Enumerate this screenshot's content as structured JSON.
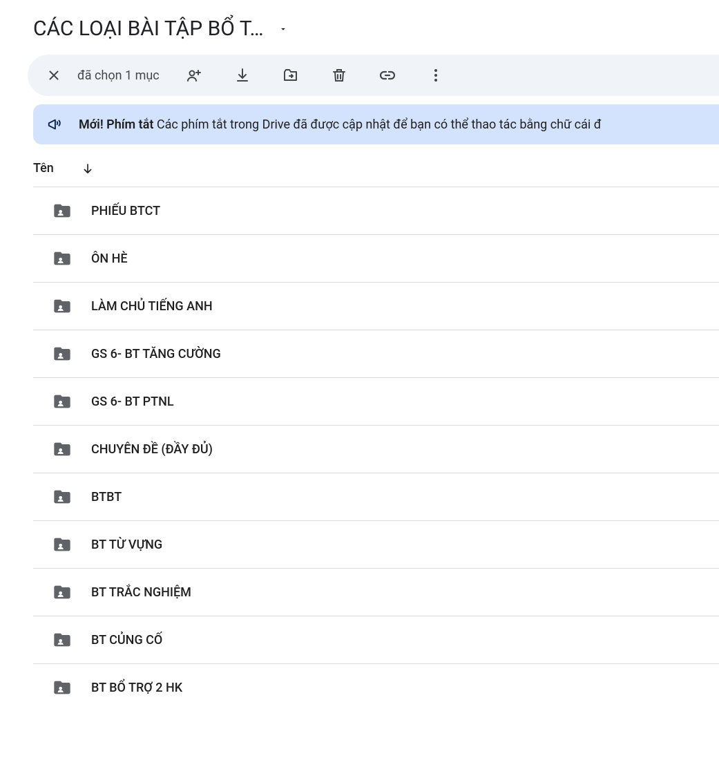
{
  "header": {
    "title": "CÁC LOẠI BÀI TẬP BỔ T…"
  },
  "toolbar": {
    "selection_text": "đã chọn 1 mục"
  },
  "banner": {
    "bold": "Mới! Phím tắt",
    "text": " Các phím tắt trong Drive đã được cập nhật để bạn có thể thao tác bằng chữ cái đ"
  },
  "columns": {
    "name": "Tên"
  },
  "files": [
    {
      "name": "PHIẾU BTCT"
    },
    {
      "name": "ÔN HÈ"
    },
    {
      "name": "LÀM CHỦ TIẾNG ANH"
    },
    {
      "name": "GS 6- BT TĂNG CƯỜNG"
    },
    {
      "name": "GS 6- BT PTNL"
    },
    {
      "name": "CHUYÊN ĐỀ (ĐẦY ĐỦ)"
    },
    {
      "name": "BTBT"
    },
    {
      "name": "BT TỪ VỰNG"
    },
    {
      "name": "BT TRẮC NGHIỆM"
    },
    {
      "name": "BT CỦNG CỐ"
    },
    {
      "name": "BT BỔ TRỢ 2 HK"
    }
  ]
}
